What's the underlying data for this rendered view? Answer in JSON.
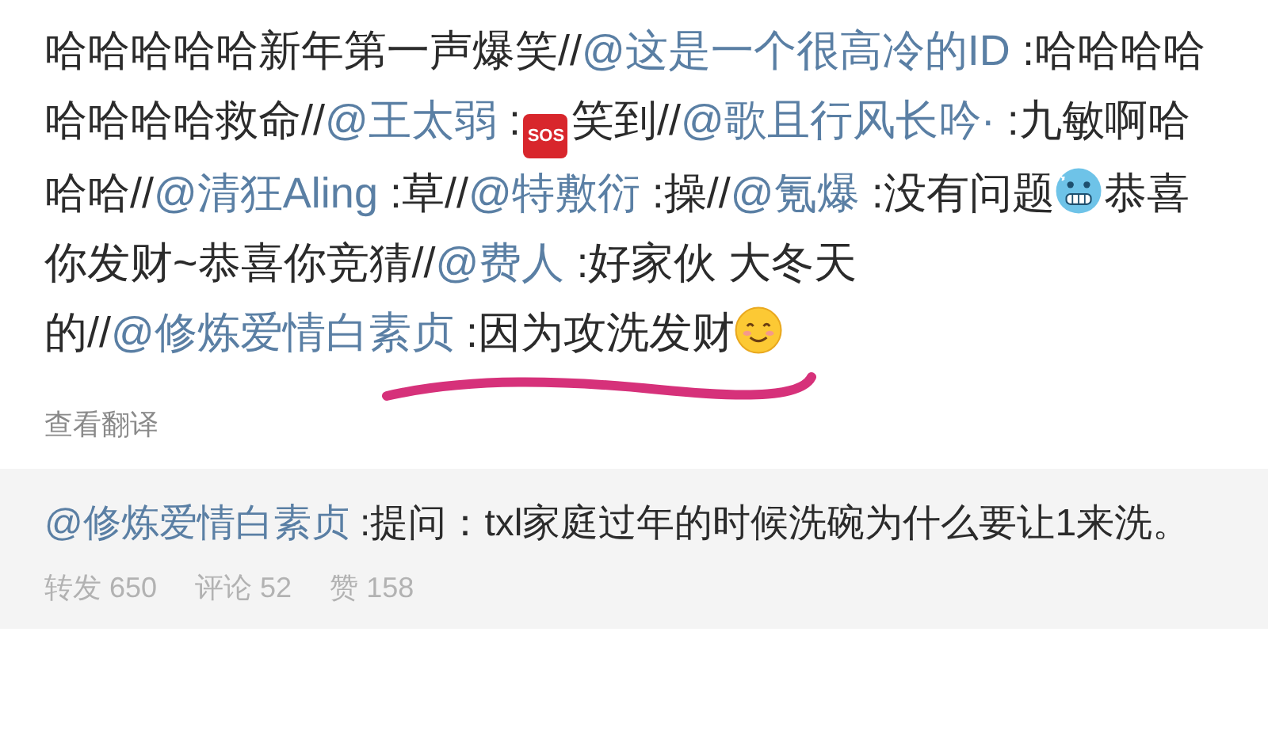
{
  "post": {
    "segments": [
      {
        "kind": "text",
        "text": "哈哈哈哈哈新年第一声爆笑//"
      },
      {
        "kind": "mention",
        "text": "@这是一个很高冷的ID"
      },
      {
        "kind": "text",
        "text": " :哈哈哈哈哈哈哈哈救命//"
      },
      {
        "kind": "mention",
        "text": "@王太弱"
      },
      {
        "kind": "text",
        "text": " :"
      },
      {
        "kind": "sos",
        "text": "SOS"
      },
      {
        "kind": "text",
        "text": "笑到//"
      },
      {
        "kind": "mention",
        "text": "@歌且行风长吟·"
      },
      {
        "kind": "text",
        "text": " :九敏啊哈哈哈//"
      },
      {
        "kind": "mention",
        "text": "@清狂Aling"
      },
      {
        "kind": "text",
        "text": " :草//"
      },
      {
        "kind": "mention",
        "text": "@特敷衍"
      },
      {
        "kind": "text",
        "text": " :操//"
      },
      {
        "kind": "mention",
        "text": "@氪爆"
      },
      {
        "kind": "text",
        "text": " :没有问题"
      },
      {
        "kind": "cold"
      },
      {
        "kind": "text",
        "text": "恭喜你发财~恭喜你竞猜//"
      },
      {
        "kind": "mention",
        "text": "@费人"
      },
      {
        "kind": "text",
        "text": " :好家伙 大冬天的//"
      },
      {
        "kind": "mention",
        "text": "@修炼爱情白素贞"
      },
      {
        "kind": "text",
        "text": " :因为攻洗发财"
      },
      {
        "kind": "smile"
      }
    ],
    "translate_link": "查看翻译"
  },
  "quoted": {
    "segments": [
      {
        "kind": "mention",
        "text": "@修炼爱情白素贞"
      },
      {
        "kind": "text",
        "text": " :提问：txl家庭过年的时候洗碗为什么要让1来洗。"
      }
    ],
    "stats": [
      {
        "label": "转发",
        "count": "650"
      },
      {
        "label": "评论",
        "count": "52"
      },
      {
        "label": "赞",
        "count": "158"
      }
    ]
  }
}
